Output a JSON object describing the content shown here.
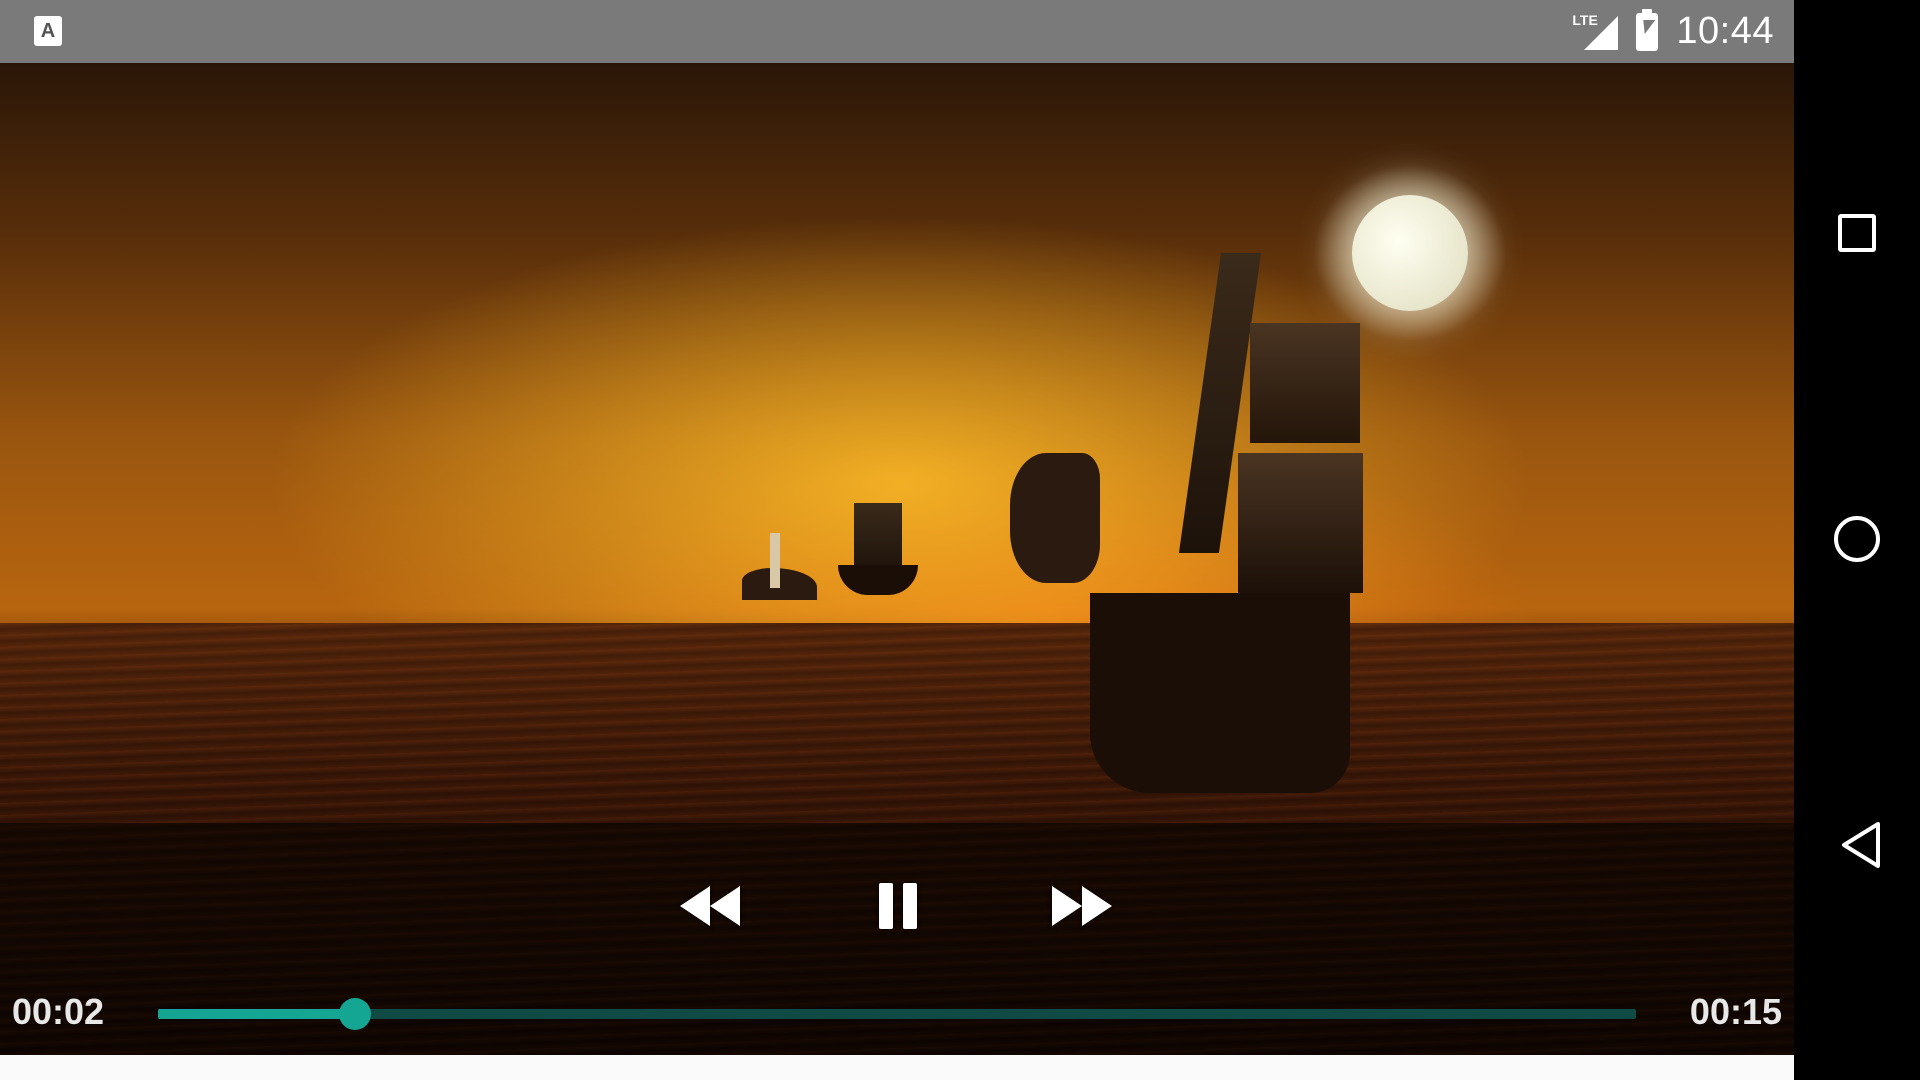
{
  "status_bar": {
    "app_icon_letter": "A",
    "network": "LTE",
    "clock": "10:44",
    "icons": [
      "app-notification-icon",
      "lte-signal-icon",
      "battery-charging-icon"
    ]
  },
  "player": {
    "current_time": "00:02",
    "duration": "00:15",
    "progress_fraction": 0.133,
    "accent_color": "#14a593",
    "controls": {
      "rewind_icon": "rewind-icon",
      "pause_icon": "pause-icon",
      "fast_forward_icon": "fast-forward-icon"
    }
  },
  "nav_bar": {
    "buttons": [
      "recents-icon",
      "home-icon",
      "back-icon"
    ]
  }
}
